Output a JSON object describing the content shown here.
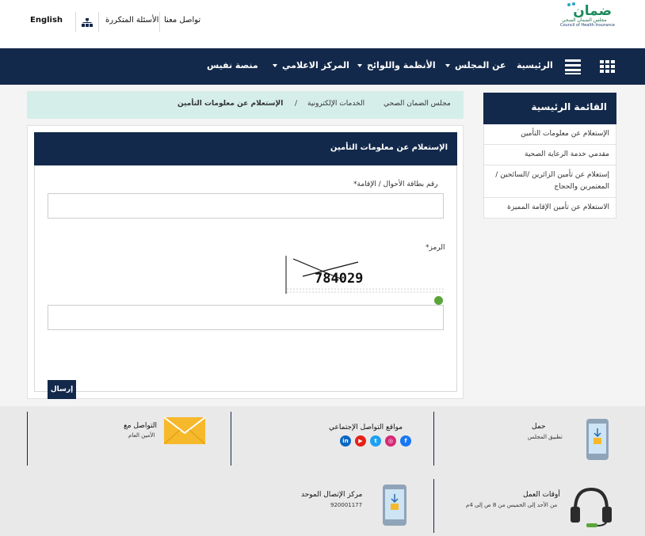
{
  "header": {
    "logo_ar": "ضمان",
    "logo_sub_ar": "مجلس الضمان الصحي",
    "logo_sub_en": "Council of Health Insurance",
    "contact": "تواصل معنا",
    "faq": "الأسئلة المتكررة",
    "language": "English"
  },
  "nav": {
    "home": "الرئيسية",
    "about": "عن المجلس",
    "regulations": "الأنظمة واللوائح",
    "media": "المركز الاعلامي",
    "nafees": "منصة نفيس"
  },
  "breadcrumb": {
    "item1": "مجلس الضمان الصحي",
    "item2": "الخدمات الإلكترونية",
    "separator": "/",
    "current": "الإستعلام عن معلومات التأمين"
  },
  "form": {
    "title": "الإستعلام عن معلومات التأمين",
    "id_label": "رقم بطاقة الأحوال / الإقامة*",
    "code_label": "الرمز*",
    "captcha_text": "784029",
    "submit": "إرسال"
  },
  "sidebar": {
    "title": "القائمة الرئيسية",
    "items": [
      {
        "label": "الإستعلام عن معلومات التأمين"
      },
      {
        "label": "مقدمي خدمة الرعاية الصحية"
      },
      {
        "label": "إستعلام عن تأمين الزائرين /السائحين /المعتمرين والحجاج"
      },
      {
        "label": "الاستعلام عن تأمين الإقامة المميزة"
      }
    ]
  },
  "footer": {
    "download_title": "حمل",
    "download_sub": "تطبيق المجلس",
    "social_title": "مواقع التواصل الإجتماعي",
    "contact_title": "التواصل مع",
    "contact_sub": "الأمين العام",
    "hours_title": "أوقات العمل",
    "hours_sub": "من الأحد إلى الخميس من 8 ص إلى 4م",
    "callcenter_title": "مركز الإتصال الموحد",
    "callcenter_number": "920001177"
  },
  "colors": {
    "navy": "#13294b",
    "mint": "#d5eee9",
    "envelope": "#f6b92b"
  }
}
